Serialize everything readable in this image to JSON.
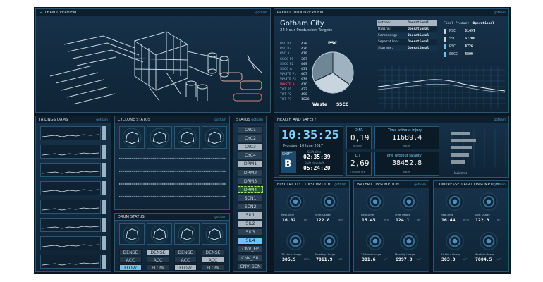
{
  "gotham_overview": {
    "title": "GOTHAM OVERVIEW",
    "tag": "gotham"
  },
  "production_overview": {
    "title": "PRODUCTION OVERVIEW",
    "tag": "gotham",
    "city": "Gotham City",
    "subtitle": "24-hour Production Targets",
    "targets": [
      "PSC P1",
      "PSC P2",
      "PSC A",
      "SSCC P1",
      "SSCC P2",
      "SSCC A",
      "WASTE P1",
      "WASTE P2",
      "WASTE A",
      "TOT P1",
      "TOT P2",
      "TOT P3"
    ],
    "target_values": [
      "428",
      "426",
      "419",
      "367",
      "449",
      "431",
      "467",
      "479",
      "410",
      "432",
      "490",
      "1026"
    ],
    "pie_labels": {
      "psc": "PSC",
      "waste": "Waste",
      "sscc": "SSCC"
    },
    "pie_slices": [
      {
        "name": "PSC",
        "fraction": 0.35,
        "color": "#9fb2c2"
      },
      {
        "name": "SSCC",
        "fraction": 0.33,
        "color": "#c8d4de"
      },
      {
        "name": "Waste",
        "fraction": 0.32,
        "color": "#6f8696"
      }
    ],
    "status": [
      {
        "k": "Gotham:",
        "v": "Operational"
      },
      {
        "k": "Mining:",
        "v": "Operational"
      },
      {
        "k": "Screening:",
        "v": "Operational"
      },
      {
        "k": "Separation:",
        "v": "Operational"
      },
      {
        "k": "Storage:",
        "v": "Operational"
      }
    ],
    "final_product_label": "Final Product:",
    "final_product_value": "Operational",
    "final": [
      {
        "k": "PSC",
        "v": "51497"
      },
      {
        "k": "SSCC",
        "v": "67206"
      },
      {
        "k": "PSC",
        "v": "4726"
      },
      {
        "k": "SSCC",
        "v": "4809"
      }
    ]
  },
  "tailings_dams": {
    "title": "TAILINGS DAMS",
    "tag": "gotham"
  },
  "cyclone_status": {
    "title": "CYCLONE STATUS",
    "tag": "gotham"
  },
  "drum_status": {
    "title": "DRUM STATUS",
    "tag": "gotham",
    "rows": [
      [
        "DENSE",
        "DENSE",
        "DENSE",
        "DENSE"
      ],
      [
        "ACC",
        "ACC",
        "ACC",
        "ACC"
      ],
      [
        "FLOW",
        "FLOW",
        "FLOW",
        "FLOW"
      ]
    ]
  },
  "status": {
    "title": "STATUS",
    "tag": "gotham",
    "items": [
      "CYC1",
      "CYC2",
      "CYC3",
      "CYC4",
      "DRM1",
      "DRM2",
      "DRM3",
      "DRM4",
      "SCN1",
      "SCN2",
      "SIL1",
      "SIL2",
      "SIL3",
      "SIL4",
      "CNV_FP",
      "CNV_SIL",
      "CNV_SCN"
    ]
  },
  "health_safety": {
    "title": "HEALTH AND SAFETY",
    "tag": "gotham",
    "clock": "10:35:25",
    "date": "Monday, 10 June 2017",
    "shift_label": "SHIFT",
    "shift": "B",
    "shift_time_label": "Shift time",
    "shift_time": "02:35:39",
    "shift_left_label": "Shift time left",
    "shift_left": "05:24:20",
    "difr_label": "DIFR",
    "difr": "0,19",
    "difr_unit": "% hours",
    "lti_label": "LTI",
    "lti": "2,69",
    "lti_unit": "/ million hrs",
    "no_injury_label": "Time without injury",
    "no_injury": "11689.4",
    "no_injury_unit": "hours",
    "no_fatal_label": "Time without fatality",
    "no_fatal": "38452.8",
    "no_fatal_unit": "hours",
    "incidents_label": "Incidents"
  },
  "electricity": {
    "title": "ELECTRICITY CONSUMPTION",
    "tag": "gotham",
    "cells": [
      {
        "label": "Real-time",
        "value": "16.02",
        "unit": "kW"
      },
      {
        "label": "Shift Usage",
        "value": "122.8",
        "unit": "kWh"
      },
      {
        "label": "24 Hour Usage",
        "value": "305.9",
        "unit": "kWh"
      },
      {
        "label": "Monthly Usage",
        "value": "7011.9",
        "unit": "kWh"
      }
    ]
  },
  "water": {
    "title": "WATER CONSUMPTION",
    "tag": "gotham",
    "cells": [
      {
        "label": "Real-time",
        "value": "15.45",
        "unit": "m³/h"
      },
      {
        "label": "Shift Usage",
        "value": "124.1",
        "unit": "m³"
      },
      {
        "label": "24 Hour Usage",
        "value": "301.6",
        "unit": "m³"
      },
      {
        "label": "Monthly Usage",
        "value": "6997.0",
        "unit": "m³"
      }
    ]
  },
  "air": {
    "title": "COMPRESSED AIR CONSUMPTION",
    "tag": "gotham",
    "cells": [
      {
        "label": "Real-time",
        "value": "16.44",
        "unit": "m³/h"
      },
      {
        "label": "Shift Usage",
        "value": "122.8",
        "unit": "m³"
      },
      {
        "label": "24 Hour Usage",
        "value": "303.0",
        "unit": "m³"
      },
      {
        "label": "Monthly Usage",
        "value": "7004.5",
        "unit": "m³"
      }
    ]
  }
}
